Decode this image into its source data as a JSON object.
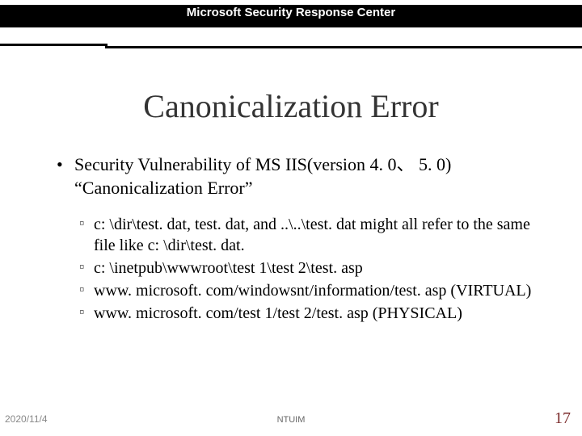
{
  "header": {
    "label": "Microsoft Security Response Center"
  },
  "title": "Canonicalization Error",
  "bullets": {
    "lvl1": "Security Vulnerability of MS IIS(version 4. 0、 5. 0)  “Canonicalization Error”",
    "lvl2": [
      "c: \\dir\\test. dat,  test. dat,  and ..\\..\\test. dat  might all refer to the same file like c: \\dir\\test. dat.",
      "c: \\inetpub\\wwwroot\\test 1\\test 2\\test. asp",
      "www. microsoft. com/windowsnt/information/test. asp  (VIRTUAL)",
      "www. microsoft. com/test 1/test 2/test. asp  (PHYSICAL)"
    ]
  },
  "footer": {
    "date": "2020/11/4",
    "center": "NTUIM",
    "page": "17"
  }
}
